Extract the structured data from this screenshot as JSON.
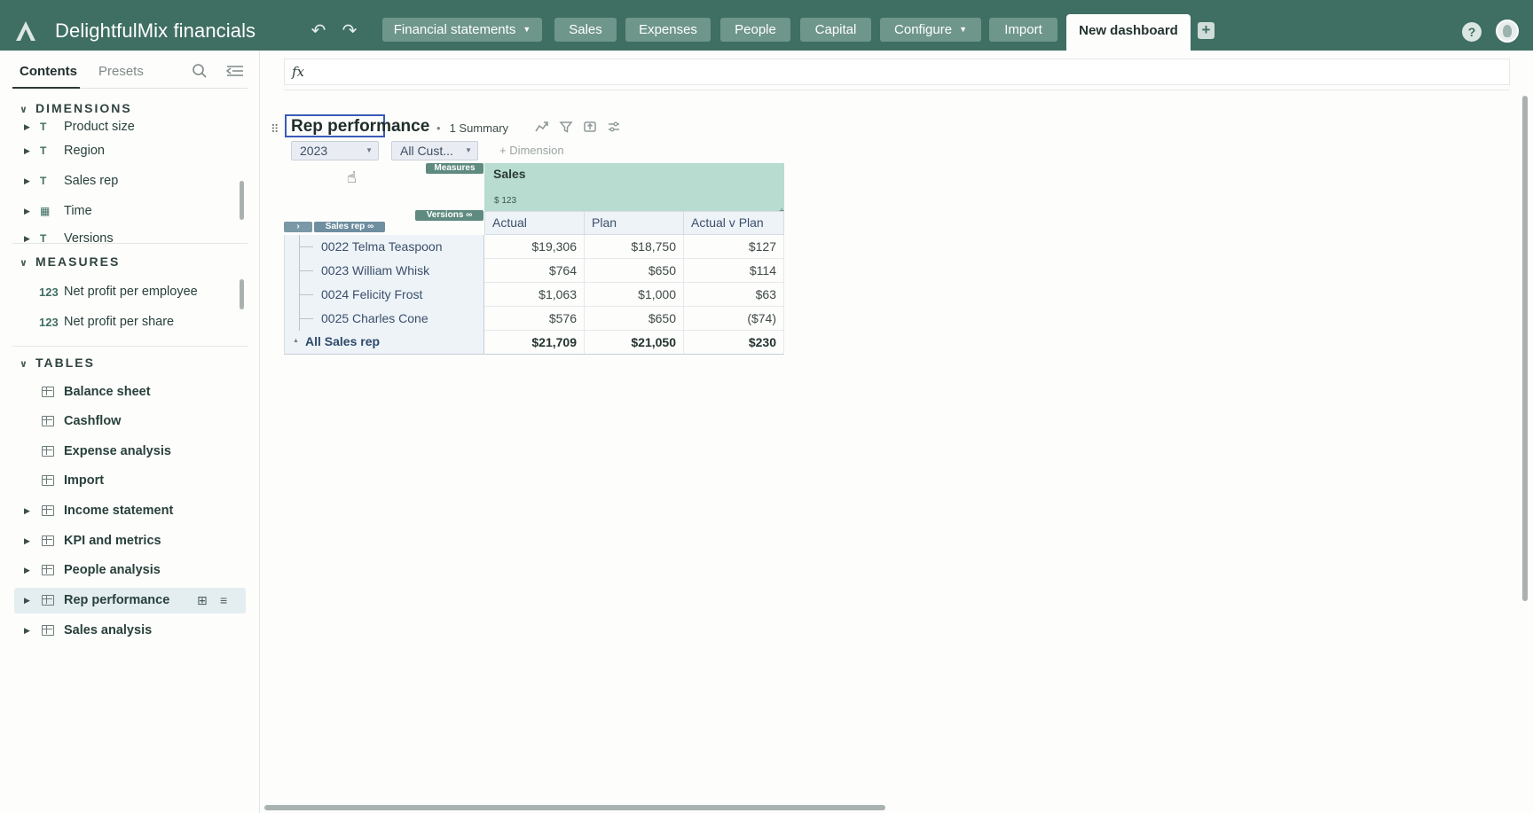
{
  "app": {
    "title": "DelightfulMix financials"
  },
  "colors": {
    "topbar": "#3f6e62",
    "nav_button": "#6f968b",
    "accent_header": "#b8dcd0",
    "pill": "#5e8a7f",
    "title_outline": "#3a5bb8"
  },
  "toolbar": {
    "undo_icon": "undo-icon",
    "redo_icon": "redo-icon",
    "nav": [
      {
        "label": "Financial statements",
        "dropdown": true
      },
      {
        "label": "Sales"
      },
      {
        "label": "Expenses"
      },
      {
        "label": "People"
      },
      {
        "label": "Capital"
      },
      {
        "label": "Configure",
        "dropdown": true
      },
      {
        "label": "Import"
      }
    ],
    "active_tab": "New dashboard",
    "help_label": "?"
  },
  "sidebar": {
    "tabs": [
      "Contents",
      "Presets"
    ],
    "sections": {
      "dimensions": "DIMENSIONS",
      "measures": "MEASURES",
      "tables": "TABLES"
    },
    "dimensions": [
      "Product size",
      "Region",
      "Sales rep",
      "Time",
      "Versions"
    ],
    "measures": [
      "Net profit per employee",
      "Net profit per share"
    ],
    "measure_icon": "123",
    "tables": [
      {
        "label": "Balance sheet",
        "expandable": false
      },
      {
        "label": "Cashflow",
        "expandable": false
      },
      {
        "label": "Expense analysis",
        "expandable": false
      },
      {
        "label": "Import",
        "expandable": false
      },
      {
        "label": "Income statement",
        "expandable": true
      },
      {
        "label": "KPI and metrics",
        "expandable": true
      },
      {
        "label": "People analysis",
        "expandable": true
      },
      {
        "label": "Rep performance",
        "expandable": true,
        "selected": true
      },
      {
        "label": "Sales analysis",
        "expandable": true
      }
    ]
  },
  "formula_bar": {
    "icon": "fx",
    "value": ""
  },
  "tile": {
    "title": "Rep performance",
    "subtitle": "1 Summary",
    "filters": [
      "2023",
      "All Cust..."
    ],
    "add_dimension": "+ Dimension",
    "pills": {
      "measures": "Measures",
      "versions": "Versions",
      "rows": "Sales rep"
    },
    "measure": {
      "name": "Sales",
      "format": "$  123"
    },
    "columns": [
      "Actual",
      "Plan",
      "Actual v Plan"
    ],
    "rows": [
      {
        "name": "0022 Telma Teaspoon",
        "values": [
          "$19,306",
          "$18,750",
          "$127"
        ]
      },
      {
        "name": "0023 William Whisk",
        "values": [
          "$764",
          "$650",
          "$114"
        ]
      },
      {
        "name": "0024 Felicity Frost",
        "values": [
          "$1,063",
          "$1,000",
          "$63"
        ]
      },
      {
        "name": "0025 Charles Cone",
        "values": [
          "$576",
          "$650",
          "($74)"
        ]
      }
    ],
    "total": {
      "name": "All Sales rep",
      "values": [
        "$21,709",
        "$21,050",
        "$230"
      ]
    }
  }
}
